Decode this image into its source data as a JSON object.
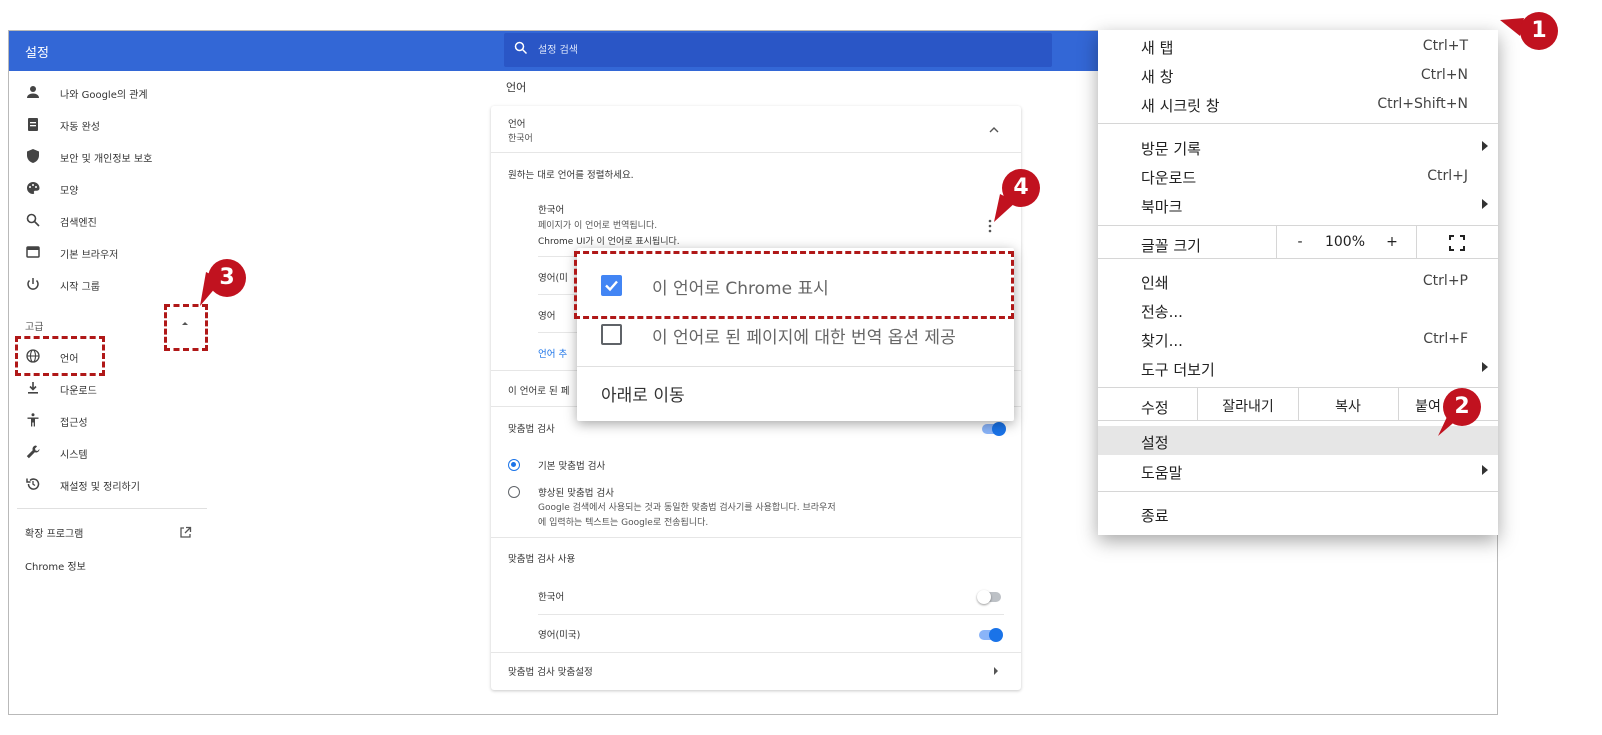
{
  "settings": {
    "title": "설정",
    "search_placeholder": "설정 검색",
    "sidebar": {
      "items": [
        {
          "label": "나와 Google의 관계",
          "icon": "person-icon"
        },
        {
          "label": "자동 완성",
          "icon": "clipboard-icon"
        },
        {
          "label": "보안 및 개인정보 보호",
          "icon": "shield-icon"
        },
        {
          "label": "모양",
          "icon": "palette-icon"
        },
        {
          "label": "검색엔진",
          "icon": "search-icon"
        },
        {
          "label": "기본 브라우저",
          "icon": "browser-icon"
        },
        {
          "label": "시작 그룹",
          "icon": "power-icon"
        }
      ],
      "advanced_label": "고급",
      "advanced_items": [
        {
          "label": "언어",
          "icon": "globe-icon"
        },
        {
          "label": "다운로드",
          "icon": "download-icon"
        },
        {
          "label": "접근성",
          "icon": "accessibility-icon"
        },
        {
          "label": "시스템",
          "icon": "wrench-icon"
        },
        {
          "label": "재설정 및 정리하기",
          "icon": "restore-icon"
        }
      ],
      "extensions_label": "확장 프로그램",
      "about_label": "Chrome 정보"
    },
    "page_heading": "언어",
    "language_card": {
      "section_title": "언어",
      "section_value": "한국어",
      "order_hint": "원하는 대로 언어를 정렬하세요.",
      "lang1_name": "한국어",
      "lang1_line1": "페이지가 이 언어로 번역됩니다.",
      "lang1_line2": "Chrome UI가 이 언어로 표시됩니다.",
      "lang2_name_partial": "영어(미",
      "lang3_name": "영어",
      "add_language_partial": "언어 추",
      "translate_offer_partial": "이 언어로 된 페",
      "spellcheck_title": "맞춤법 검사",
      "basic_spellcheck": "기본 맞춤법 검사",
      "enhanced_spellcheck": "향상된 맞춤법 검사",
      "enhanced_desc_1": "Google 검색에서 사용되는 것과 동일한 맞춤법 검사기를 사용합니다. 브라우저",
      "enhanced_desc_2": "에 입력하는 텍스트는 Google로 전송됩니다.",
      "spellcheck_use": "맞춤법 검사 사용",
      "spell_lang_ko": "한국어",
      "spell_lang_en": "영어(미국)",
      "spellcheck_custom": "맞춤법 검사 맞춤설정"
    },
    "language_popup": {
      "option_display": "이 언어로 Chrome 표시",
      "option_translate": "이 언어로 된 페이지에 대한 번역 옵션 제공",
      "move_down": "아래로 이동",
      "display_checked": true,
      "translate_checked": false
    }
  },
  "chrome_menu": {
    "new_tab": "새 탭",
    "new_tab_sc": "Ctrl+T",
    "new_window": "새 창",
    "new_window_sc": "Ctrl+N",
    "incognito": "새 시크릿 창",
    "incognito_sc": "Ctrl+Shift+N",
    "history": "방문 기록",
    "downloads": "다운로드",
    "downloads_sc": "Ctrl+J",
    "bookmarks": "북마크",
    "zoom_label": "글꼴 크기",
    "zoom_minus": "-",
    "zoom_value": "100%",
    "zoom_plus": "+",
    "print": "인쇄",
    "print_sc": "Ctrl+P",
    "cast": "전송...",
    "find": "찾기...",
    "find_sc": "Ctrl+F",
    "more_tools": "도구 더보기",
    "edit_label": "수정",
    "cut": "잘라내기",
    "copy": "복사",
    "paste_partial": "붙여",
    "settings": "설정",
    "help": "도움말",
    "exit": "종료"
  },
  "annotations": {
    "badge1": "1",
    "badge2": "2",
    "badge3": "3",
    "badge4": "4",
    "badge_color": "#c1121f",
    "highlight_color": "#b01818"
  },
  "colors": {
    "header_blue": "#3367d6",
    "accent_blue": "#1a73e8"
  }
}
